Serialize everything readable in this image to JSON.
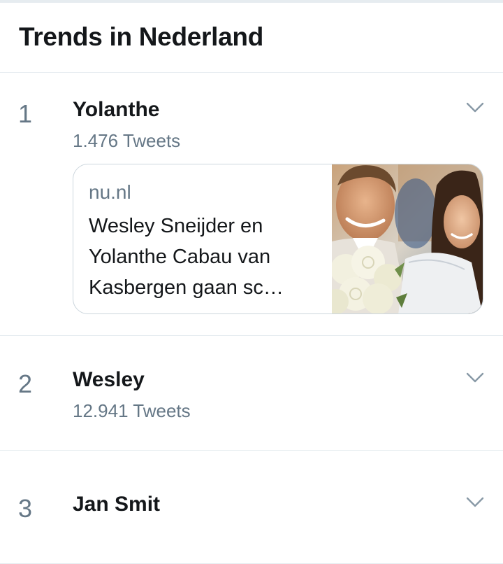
{
  "header": {
    "title": "Trends in Nederland"
  },
  "trends": [
    {
      "rank": "1",
      "name": "Yolanthe",
      "tweets": "1.476 Tweets",
      "card": {
        "source": "nu.nl",
        "headline": "Wesley Sneijder en Yolanthe Cabau van Kasbergen gaan sc…"
      }
    },
    {
      "rank": "2",
      "name": "Wesley",
      "tweets": "12.941 Tweets"
    },
    {
      "rank": "3",
      "name": "Jan Smit"
    }
  ],
  "icons": {
    "chevron": "chevron-down-icon"
  },
  "colors": {
    "text_primary": "#14171a",
    "text_secondary": "#657786",
    "divider": "#e6ecf0",
    "card_border": "#ccd6dd"
  }
}
